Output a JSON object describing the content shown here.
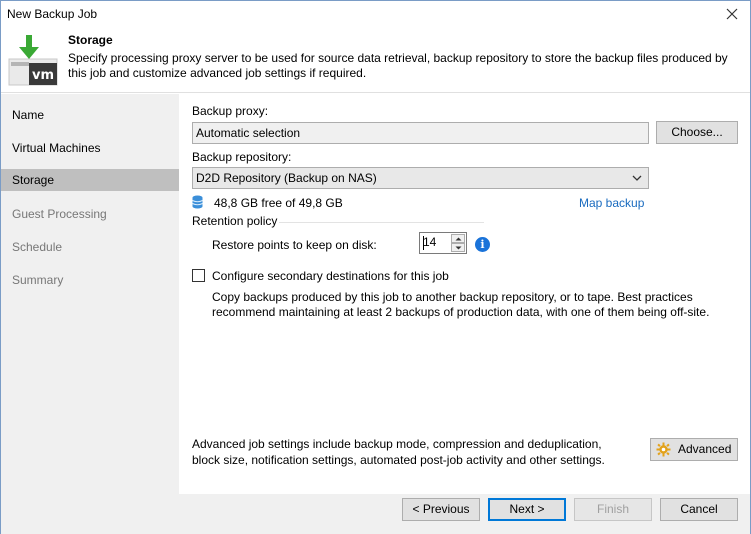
{
  "window": {
    "title": "New Backup Job"
  },
  "header": {
    "title": "Storage",
    "description": "Specify processing proxy server to be used for source data retrieval, backup repository to store the backup files produced by this job and customize advanced job settings if required.",
    "icon_text": "vm"
  },
  "sidebar": {
    "items": [
      {
        "label": "Name",
        "state": "enabled"
      },
      {
        "label": "Virtual Machines",
        "state": "enabled"
      },
      {
        "label": "Storage",
        "state": "active"
      },
      {
        "label": "Guest Processing",
        "state": "disabled"
      },
      {
        "label": "Schedule",
        "state": "disabled"
      },
      {
        "label": "Summary",
        "state": "disabled"
      }
    ]
  },
  "storage": {
    "proxy_label": "Backup proxy:",
    "proxy_value": "Automatic selection",
    "choose_button": "Choose...",
    "repository_label": "Backup repository:",
    "repository_value": "D2D Repository (Backup on NAS)",
    "free_space": "48,8 GB free of 49,8 GB",
    "map_backup_link": "Map backup",
    "retention_label": "Retention policy",
    "restore_points_label": "Restore points to keep on disk:",
    "restore_points_value": "14",
    "secondary_checkbox_label": "Configure secondary destinations for this job",
    "secondary_checked": false,
    "secondary_desc": "Copy backups produced by this job to another backup repository, or to tape. Best practices recommend maintaining at least 2 backups of production data, with one of them being off-site.",
    "advanced_desc": "Advanced job settings include backup mode, compression and deduplication, block size, notification settings, automated post-job activity and other settings.",
    "advanced_button": "Advanced"
  },
  "footer": {
    "previous": "< Previous",
    "next": "Next >",
    "finish": "Finish",
    "cancel": "Cancel"
  },
  "colors": {
    "accent": "#0078d7",
    "link": "#1a6bbf",
    "icon_green": "#3aa935",
    "sidebar_bg": "#f0f0f0",
    "active_item": "#bfbfbf"
  }
}
